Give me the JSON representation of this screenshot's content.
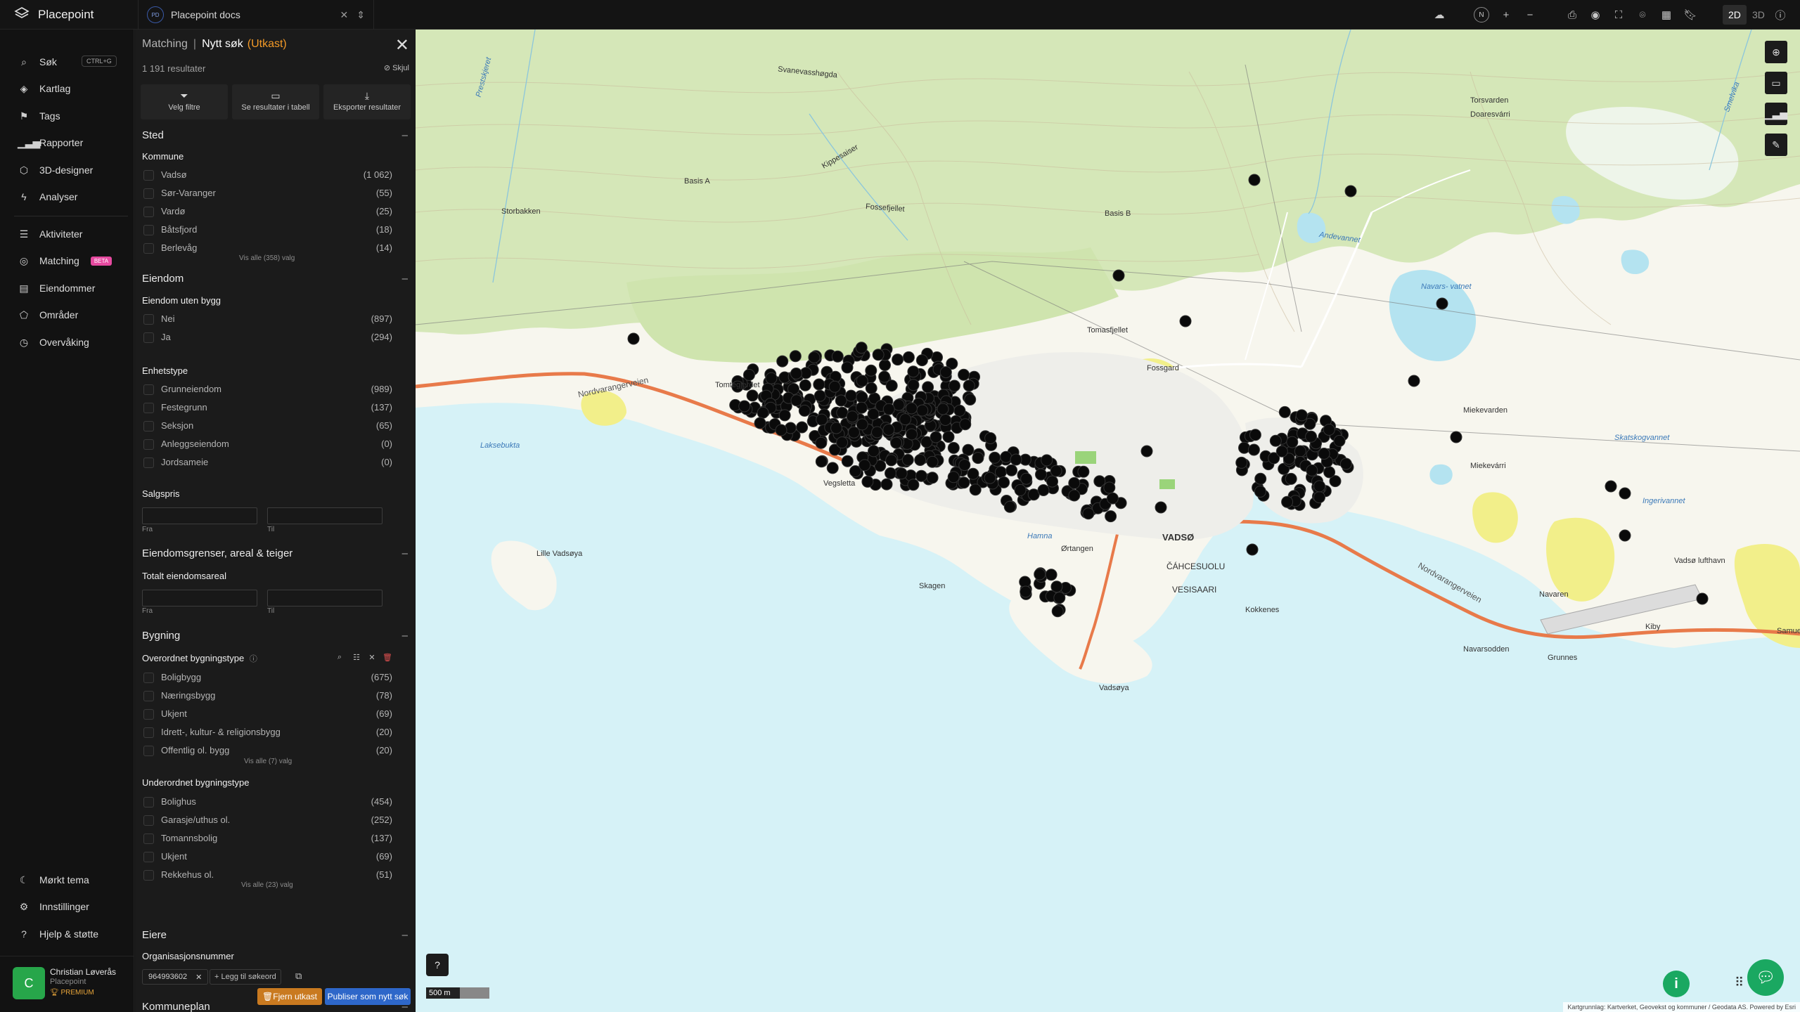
{
  "app": {
    "name": "Placepoint"
  },
  "topbar": {
    "doc_badge": "PD",
    "doc_title": "Placepoint docs",
    "mode_2d": "2D",
    "mode_3d": "3D",
    "compass": "N"
  },
  "nav": {
    "items": [
      {
        "label": "Søk",
        "icon": "search-icon",
        "shortcut": "CTRL+G"
      },
      {
        "label": "Kartlag",
        "icon": "layers-icon"
      },
      {
        "label": "Tags",
        "icon": "bookmark-icon"
      },
      {
        "label": "Rapporter",
        "icon": "chart-icon"
      },
      {
        "label": "3D-designer",
        "icon": "cube-icon"
      },
      {
        "label": "Analyser",
        "icon": "bolt-icon"
      },
      {
        "label": "Aktiviteter",
        "icon": "activity-icon"
      },
      {
        "label": "Matching",
        "icon": "target-icon",
        "badge": "BETA"
      },
      {
        "label": "Eiendommer",
        "icon": "document-icon"
      },
      {
        "label": "Områder",
        "icon": "area-icon"
      },
      {
        "label": "Overvåking",
        "icon": "monitor-icon"
      }
    ],
    "bottom": [
      {
        "label": "Mørkt tema",
        "icon": "moon-icon"
      },
      {
        "label": "Innstillinger",
        "icon": "gear-icon"
      },
      {
        "label": "Hjelp & støtte",
        "icon": "help-icon"
      }
    ],
    "user": {
      "initial": "C",
      "name": "Christian Løverås",
      "org": "Placepoint",
      "plan": "PREMIUM"
    }
  },
  "panel": {
    "crumb": "Matching",
    "current": "Nytt søk",
    "draft": "(Utkast)",
    "results": "1 191 resultater",
    "hide": "Skjul",
    "actions": [
      "Velg filtre",
      "Se resultater i tabell",
      "Eksporter resultater"
    ],
    "sted": {
      "title": "Sted",
      "kommune_title": "Kommune",
      "kommune": [
        {
          "label": "Vadsø",
          "count": "(1 062)"
        },
        {
          "label": "Sør-Varanger",
          "count": "(55)"
        },
        {
          "label": "Vardø",
          "count": "(25)"
        },
        {
          "label": "Båtsfjord",
          "count": "(18)"
        },
        {
          "label": "Berlevåg",
          "count": "(14)"
        }
      ],
      "vis_alle": "Vis alle (358) valg"
    },
    "eiendom": {
      "title": "Eiendom",
      "uten_bygg_title": "Eiendom uten bygg",
      "uten_bygg": [
        {
          "label": "Nei",
          "count": "(897)"
        },
        {
          "label": "Ja",
          "count": "(294)"
        }
      ],
      "enhetstype_title": "Enhetstype",
      "enhetstype": [
        {
          "label": "Grunneiendom",
          "count": "(989)"
        },
        {
          "label": "Festegrunn",
          "count": "(137)"
        },
        {
          "label": "Seksjon",
          "count": "(65)"
        },
        {
          "label": "Anleggseiendom",
          "count": "(0)"
        },
        {
          "label": "Jordsameie",
          "count": "(0)"
        }
      ],
      "salgspris_title": "Salgspris",
      "fra": "Fra",
      "til": "Til"
    },
    "grenser": {
      "title": "Eiendomsgrenser, areal & teiger",
      "areal_title": "Totalt eiendomsareal",
      "fra": "Fra",
      "til": "Til"
    },
    "bygning": {
      "title": "Bygning",
      "overordnet_title": "Overordnet bygningstype",
      "overordnet": [
        {
          "label": "Boligbygg",
          "count": "(675)"
        },
        {
          "label": "Næringsbygg",
          "count": "(78)"
        },
        {
          "label": "Ukjent",
          "count": "(69)"
        },
        {
          "label": "Idrett-, kultur- & religionsbygg",
          "count": "(20)"
        },
        {
          "label": "Offentlig ol. bygg",
          "count": "(20)"
        }
      ],
      "overordnet_vis_alle": "Vis alle (7) valg",
      "underordnet_title": "Underordnet bygningstype",
      "underordnet": [
        {
          "label": "Bolighus",
          "count": "(454)"
        },
        {
          "label": "Garasje/uthus ol.",
          "count": "(252)"
        },
        {
          "label": "Tomannsbolig",
          "count": "(137)"
        },
        {
          "label": "Ukjent",
          "count": "(69)"
        },
        {
          "label": "Rekkehus ol.",
          "count": "(51)"
        }
      ],
      "underordnet_vis_alle": "Vis alle (23) valg"
    },
    "eiere": {
      "title": "Eiere",
      "org_title": "Organisasjonsnummer",
      "tag": "964993602",
      "add": "Legg til søkeord"
    },
    "kommuneplan": {
      "title": "Kommuneplan"
    },
    "footer": {
      "remove": "Fjern utkast",
      "publish": "Publiser som nytt søk"
    }
  },
  "map": {
    "labels": {
      "svanevasshogda": "Svanevasshøgda",
      "basis_a": "Basis A",
      "basis_b": "Basis B",
      "storbakken": "Storbakken",
      "fosseljellet": "Fossefjellet",
      "kippesaiser": "Kippesaiser",
      "torsvarden": "Torsvarden",
      "doaresvarri": "Doaresvárri",
      "andevannet": "Andevannet",
      "navarsvatnet": "Navars-\nvatnet",
      "nordvarangerveien1": "Nordvarangerveien",
      "nordvarangerveien2": "Nordvarangerveien",
      "laksebukta": "Laksebukta",
      "vegsletta": "Vegsletta",
      "lille_vadsoya": "Lille Vadsøya",
      "hamna": "Hamna",
      "ortangen": "Ørtangen",
      "vadso": "VADSØ",
      "cahcesuolu": "ČÁHCESUOLU",
      "vesisaari": "VESISAARI",
      "kokkenes": "Kokkenes",
      "skagen": "Skagen",
      "vadsoya": "Vadsøya",
      "navarsodden": "Navarsodden",
      "grunnes": "Grunnes",
      "navaren": "Navaren",
      "kiby": "Kiby",
      "samuel": "Samue",
      "vadso_lufthavn": "Vadsø lufthavn",
      "miekevarden": "Miekevarden",
      "miekevarri": "Miekevárri",
      "ingerivannet": "Ingerivannet",
      "skatskogvannet": "Skatskogvannet",
      "fossgard": "Fossgard",
      "tomtegjerdet": "Tomtegjerdet",
      "trollhaugen": "Tomasfjellet",
      "varvnd": "Smelvika",
      "prestkeiet": "Prestskjeret"
    },
    "scale": "500 m",
    "attribution": "Kartgrunnlag: Kartverket, Geovekst og kommuner / Geodata AS. Powered by Esri"
  }
}
